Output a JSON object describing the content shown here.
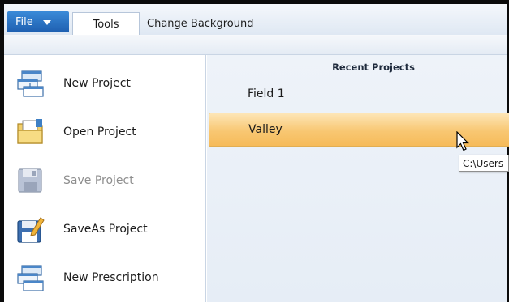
{
  "ribbon": {
    "file_label": "File",
    "tabs": [
      {
        "label": "Tools"
      },
      {
        "label": "Change Background"
      }
    ]
  },
  "menu": {
    "items": [
      {
        "label": "New Project",
        "icon": "new-project-icon",
        "enabled": true
      },
      {
        "label": "Open Project",
        "icon": "open-folder-icon",
        "enabled": true
      },
      {
        "label": "Save Project",
        "icon": "save-icon",
        "enabled": false
      },
      {
        "label": "SaveAs Project",
        "icon": "save-as-icon",
        "enabled": true
      },
      {
        "label": "New Prescription",
        "icon": "new-prescription-icon",
        "enabled": true
      }
    ]
  },
  "recent": {
    "title": "Recent Projects",
    "items": [
      {
        "name": "Field 1",
        "selected": false
      },
      {
        "name": "Valley",
        "selected": true
      }
    ],
    "tooltip": "C:\\Users"
  },
  "colors": {
    "file_tab": "#2a74c6",
    "selected_row": "#f8c772",
    "right_pane": "#eaf0f8"
  }
}
